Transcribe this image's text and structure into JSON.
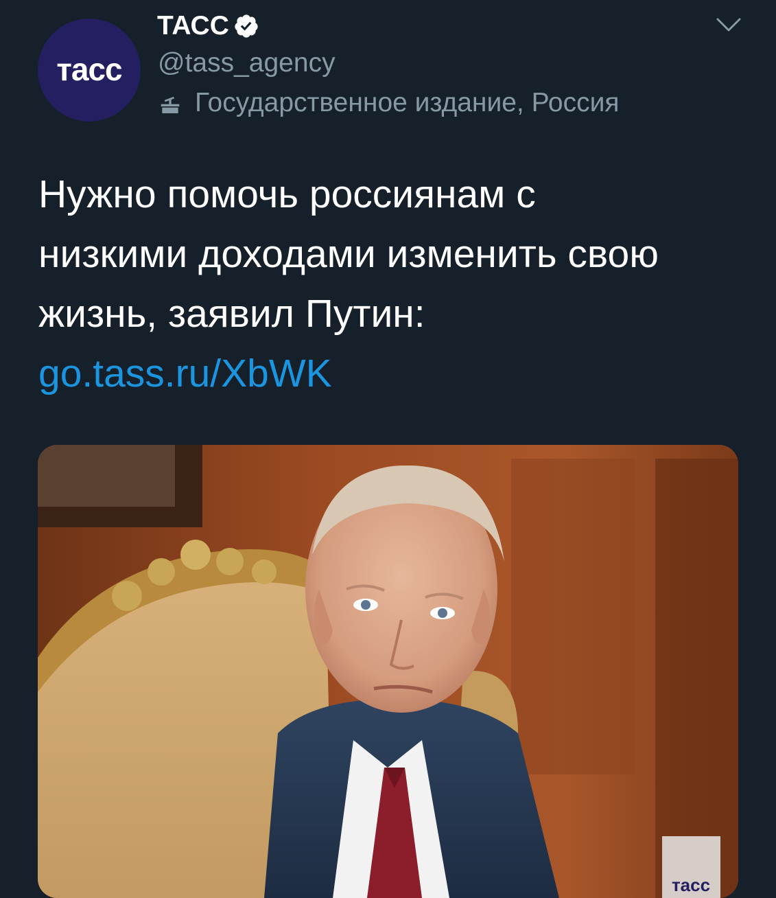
{
  "account": {
    "display_name": "ТАСС",
    "handle": "@tass_agency",
    "label": "Государственное издание, Россия",
    "avatar_text": "тасс",
    "verified_icon": "verified-badge-icon",
    "label_icon": "state-media-icon"
  },
  "tweet": {
    "line1": "Нужно помочь россиянам с",
    "line2": "низкими доходами изменить свою",
    "line3": "жизнь, заявил Путин:",
    "link": "go.tass.ru/XbWK"
  },
  "media": {
    "watermark": "тасс"
  },
  "colors": {
    "background": "#15202b",
    "secondary_text": "#8899a6",
    "link": "#1b95e0",
    "avatar_bg": "#241f61"
  }
}
